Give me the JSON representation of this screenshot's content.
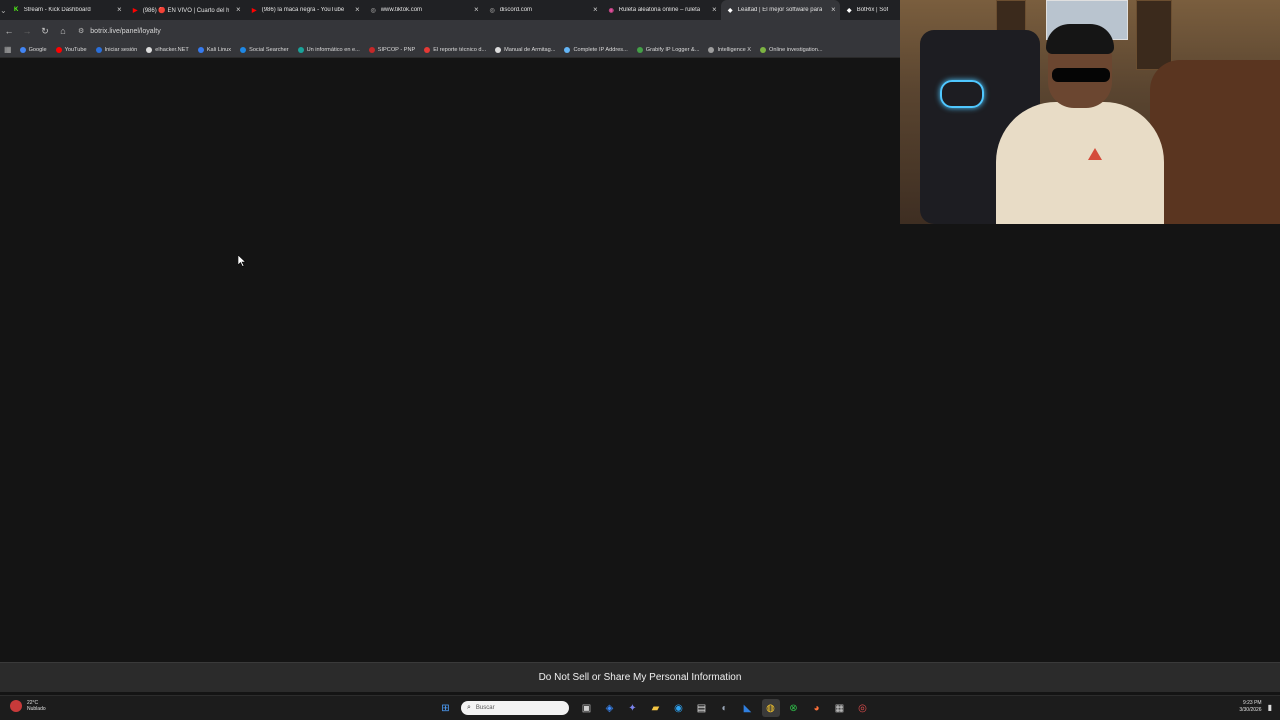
{
  "browser": {
    "tabs": [
      {
        "title": "Stream - Kick Dashboard",
        "favicon_color": "#53fc18",
        "favicon_glyph": "K",
        "active": false
      },
      {
        "title": "(986) 🔴 EN VIVO | Cuarto del h",
        "favicon_color": "#ff0000",
        "favicon_glyph": "▶",
        "active": false
      },
      {
        "title": "(986) la maca negra - YouTube",
        "favicon_color": "#ff0000",
        "favicon_glyph": "▶",
        "active": false
      },
      {
        "title": "www.tiktok.com",
        "favicon_color": "#888888",
        "favicon_glyph": "◎",
        "active": false
      },
      {
        "title": "discord.com",
        "favicon_color": "#888888",
        "favicon_glyph": "◎",
        "active": false
      },
      {
        "title": "Ruleta aleatoria online – ruleta",
        "favicon_color": "#e34d9b",
        "favicon_glyph": "◉",
        "active": false
      },
      {
        "title": "Lealtad | El mejor software para",
        "favicon_color": "#ffffff",
        "favicon_glyph": "◆",
        "active": true
      },
      {
        "title": "BotRix | Sof",
        "favicon_color": "#ffffff",
        "favicon_glyph": "◆",
        "active": false
      }
    ],
    "address": "botrix.live/panel/loyalty",
    "bookmarks": [
      {
        "label": "Google",
        "color": "#4285f4"
      },
      {
        "label": "YouTube",
        "color": "#ff0000"
      },
      {
        "label": "Iniciar sesión",
        "color": "#2a6fdb"
      },
      {
        "label": "elhacker.NET",
        "color": "#dddddd"
      },
      {
        "label": "Kali Linux",
        "color": "#367bf0"
      },
      {
        "label": "Social Searcher",
        "color": "#1e88e5"
      },
      {
        "label": "Un informático en e...",
        "color": "#1aa39a"
      },
      {
        "label": "SIPCOP - PNP",
        "color": "#c62828"
      },
      {
        "label": "El reporte técnico d...",
        "color": "#e53935"
      },
      {
        "label": "Manual de Armitag...",
        "color": "#dddddd"
      },
      {
        "label": "Complete IP Addres...",
        "color": "#64b5f6"
      },
      {
        "label": "Grabify IP Logger &...",
        "color": "#43a047"
      },
      {
        "label": "Intelligence X",
        "color": "#9e9e9e"
      },
      {
        "label": "Online investigation...",
        "color": "#7cb342"
      }
    ]
  },
  "page": {
    "privacy_link": "Do Not Sell or Share My Personal Information"
  },
  "taskbar": {
    "weather_temp": "22°C",
    "weather_desc": "Nublado",
    "search_placeholder": "Buscar",
    "time": "9:23 PM",
    "date": "3/30/2026"
  }
}
